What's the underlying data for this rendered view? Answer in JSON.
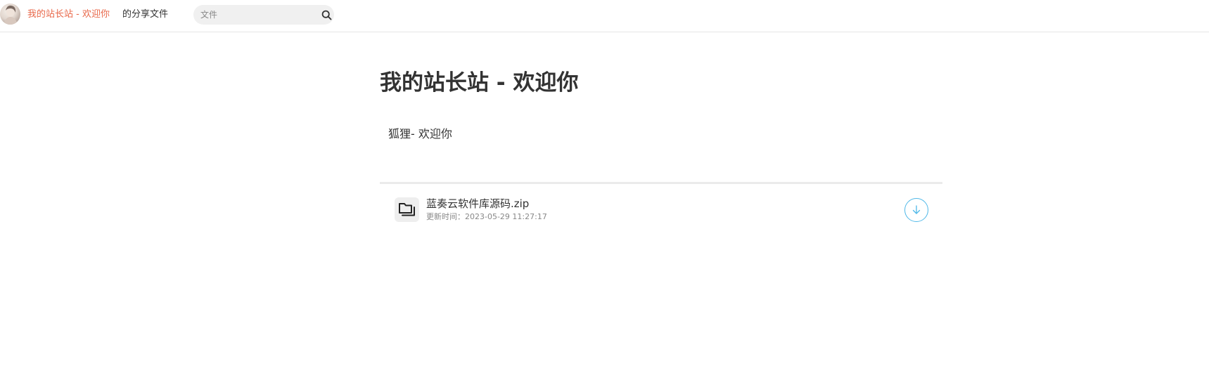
{
  "header": {
    "site_name": "我的站长站 - 欢迎你",
    "share_label": "的分享文件",
    "search": {
      "value": "",
      "placeholder": "文件",
      "icon": "search-icon"
    },
    "avatar_icon": "avatar"
  },
  "main": {
    "title": "我的站长站 - 欢迎你",
    "description": "狐狸- 欢迎你"
  },
  "files": [
    {
      "name": "蓝奏云软件库源码.zip",
      "meta": "更新时间：2023-05-29 11:27:17",
      "icon": "folder-icon",
      "action_icon": "download-icon"
    }
  ],
  "colors": {
    "accent": "#e8684a",
    "download": "#4fb8e8",
    "text": "#333333",
    "muted": "#888888"
  }
}
